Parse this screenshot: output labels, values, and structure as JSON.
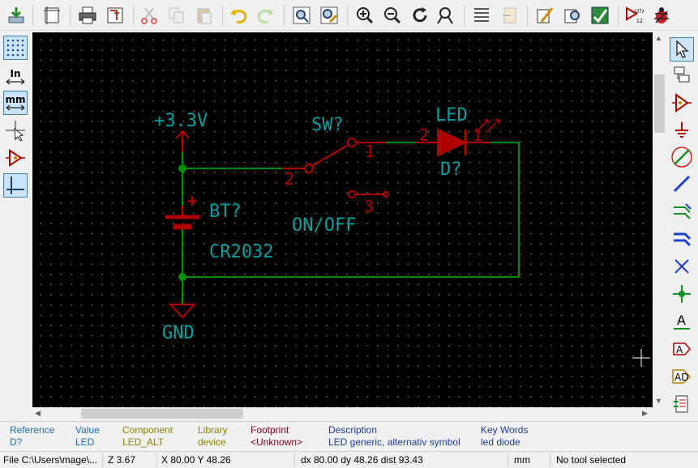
{
  "toolbar": {
    "buttons": [
      "save-icon",
      "page-settings-icon",
      "print-icon",
      "plot-icon",
      "cut-icon",
      "copy-icon",
      "paste-icon",
      "undo-icon",
      "redo-icon",
      "find-icon",
      "find-replace-icon",
      "zoom-in-icon",
      "zoom-out-icon",
      "zoom-redraw-icon",
      "zoom-fit-icon",
      "hierarchy-navigator-icon",
      "leave-sheet-icon",
      "library-editor-icon",
      "library-browser-icon",
      "annotate-icon",
      "erc-icon",
      "netlist-icon",
      "bom-icon"
    ]
  },
  "left_toolbar": {
    "grid_toggle": "grid-icon",
    "units_in_label": "In",
    "units_mm_label": "mm"
  },
  "schematic": {
    "power_label": "+3.3V",
    "ground_label": "GND",
    "battery_ref": "BT?",
    "battery_value": "CR2032",
    "battery_plus": "+",
    "switch_ref": "SW?",
    "switch_value": "ON/OFF",
    "switch_pin1": "1",
    "switch_pin2": "2",
    "switch_pin3": "3",
    "led_value": "LED",
    "led_ref": "D?",
    "led_pin1": "1",
    "led_pin2": "2"
  },
  "colors": {
    "wire": "#009000",
    "component": "#b00000",
    "text": "#00a0a0",
    "highlight_circle": "#e00000"
  },
  "info_panel": {
    "reference_label": "Reference",
    "reference_value": "D?",
    "value_label": "Value",
    "value_value": "LED",
    "component_label": "Component",
    "component_value": "LED_ALT",
    "library_label": "Library",
    "library_value": "device",
    "footprint_label": "Footprint",
    "footprint_value": "<Unknown>",
    "description_label": "Description",
    "description_value": "LED generic, alternativ symbol",
    "keywords_label": "Key Words",
    "keywords_value": "led diode"
  },
  "status_bar": {
    "file": "File C:\\Users\\mage\\...",
    "zoom": "Z 3.67",
    "xy": "X 80.00  Y 48.26",
    "delta": "dx 80.00  dy 48.26  dist 93.43",
    "units": "mm",
    "tool": "No tool selected"
  }
}
